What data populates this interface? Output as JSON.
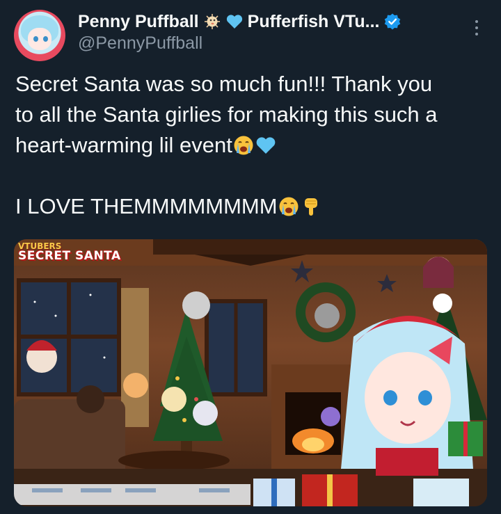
{
  "author": {
    "display_name": "Penny Puffball",
    "name_suffix": "Pufferfish VTu...",
    "handle": "@PennyPuffball",
    "name_icons": [
      "pufferfish-icon",
      "light-blue-heart-icon"
    ],
    "verified_icon": "verified-badge-icon"
  },
  "tweet": {
    "lines": [
      "Secret Santa was so much fun!!! Thank you",
      "to all the Santa girlies for making this such a",
      "heart-warming lil event"
    ],
    "line2": "I LOVE THEMMMMMMMM",
    "emojis_after_event": [
      "crying-face-icon",
      "light-blue-heart-icon"
    ],
    "emojis_after_love": [
      "crying-face-icon",
      "pointing-down-icon"
    ]
  },
  "media": {
    "logo_line1": "VTUBERS",
    "logo_line2": "SECRET SANTA"
  },
  "colors": {
    "background": "#15202b",
    "text": "#f7f9f9",
    "secondary_text": "#8b98a5",
    "verified": "#1d9bf0",
    "heart": "#5fc4f2"
  },
  "icons": {
    "more": "more-options-icon"
  }
}
